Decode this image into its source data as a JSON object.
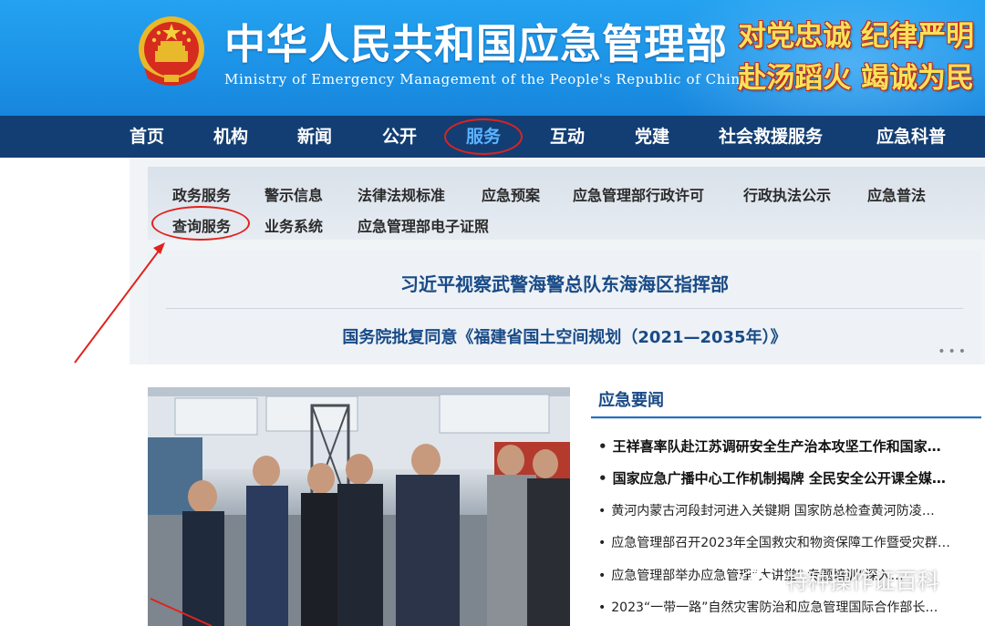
{
  "header": {
    "title": "中华人民共和国应急管理部",
    "subtitle": "Ministry of Emergency Management of the People's Republic of China",
    "slogan_line1": "对党忠诚 纪律严明",
    "slogan_line2": "赴汤蹈火 竭诚为民",
    "emblem_icon": "national-emblem-icon"
  },
  "nav": {
    "items": [
      "首页",
      "机构",
      "新闻",
      "公开",
      "服务",
      "互动",
      "党建",
      "社会救援服务",
      "应急科普"
    ],
    "active": "服务"
  },
  "submenu": {
    "row1": [
      "政务服务",
      "警示信息",
      "法律法规标准",
      "应急预案",
      "应急管理部行政许可",
      "行政执法公示",
      "应急普法"
    ],
    "row2": [
      "查询服务",
      "业务系统",
      "应急管理部电子证照"
    ]
  },
  "headlines": {
    "primary": "习近平视察武警海警总队东海海区指挥部",
    "secondary": "国务院批复同意《福建省国土空间规划（2021—2035年）》",
    "more": "•••"
  },
  "news": {
    "title": "应急要闻",
    "items": [
      "王祥喜率队赴江苏调研安全生产治本攻坚工作和国家…",
      "国家应急广播中心工作机制揭牌  全民安全公开课全媒…",
      "黄河内蒙古河段封河进入关键期  国家防总检查黄河防凌…",
      "应急管理部召开2023年全国救灾和物资保障工作暨受灾群…",
      "应急管理部举办应急管理“大讲堂”  专题培训“深入…",
      "2023“一带一路”自然灾害防治和应急管理国际合作部长…"
    ]
  },
  "watermark": "特种操作证百科",
  "colors": {
    "header_blue": "#1c92e6",
    "nav_navy": "#133e74",
    "slogan_yellow": "#f6e25a",
    "highlight_red": "#e0231c",
    "link_blue": "#184a86"
  }
}
